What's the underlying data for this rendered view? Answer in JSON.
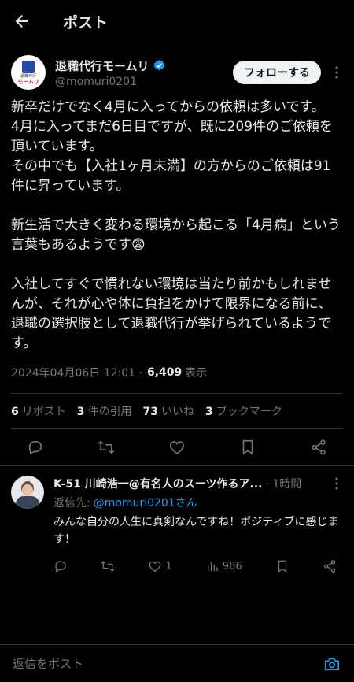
{
  "header": {
    "title": "ポスト",
    "back_icon": "arrow-left-icon"
  },
  "post": {
    "display_name": "退職代行モームリ",
    "handle": "@momuri0201",
    "verified": true,
    "avatar": {
      "line1": "退職代行",
      "line2": "モームリ"
    },
    "follow_label": "フォローする",
    "text": "新卒だけでなく4月に入ってからの依頼は多いです。\n4月に入ってまだ6日目ですが、既に209件のご依頼を頂いています。\nその中でも【入社1ヶ月未満】の方からのご依頼は91件に昇っています。\n\n新生活で大きく変わる環境から起こる「4月病」という言葉もあるようです😨\n\n入社してすぐで慣れない環境は当たり前かもしれませんが、それが心や体に負担をかけて限界になる前に、退職の選択肢として退職代行が挙げられているようです。",
    "timestamp": "2024年04月06日 12:01 ·",
    "views": "6,409",
    "views_label": "表示",
    "stats": {
      "reposts": "6",
      "reposts_label": "リポスト",
      "quotes": "3",
      "quotes_label": "件の引用",
      "likes": "73",
      "likes_label": "いいね",
      "bookmarks": "3",
      "bookmarks_label": "ブックマーク"
    }
  },
  "reply": {
    "name": "K-51 川崎浩一@有名人のスーツ作るア...",
    "time": "· 1時間",
    "replying_to_label": "返信先:",
    "replying_to": "@momuri0201さん",
    "text": "みんな自分の人生に真剣なんですね！ポジティブに感じます！",
    "likes": "1",
    "views": "986"
  },
  "compose": {
    "placeholder": "返信をポスト"
  },
  "colors": {
    "background": "#000000",
    "text": "#e7e9ea",
    "muted": "#71767b",
    "accent": "#1d9bf0",
    "divider": "#2f3336"
  }
}
